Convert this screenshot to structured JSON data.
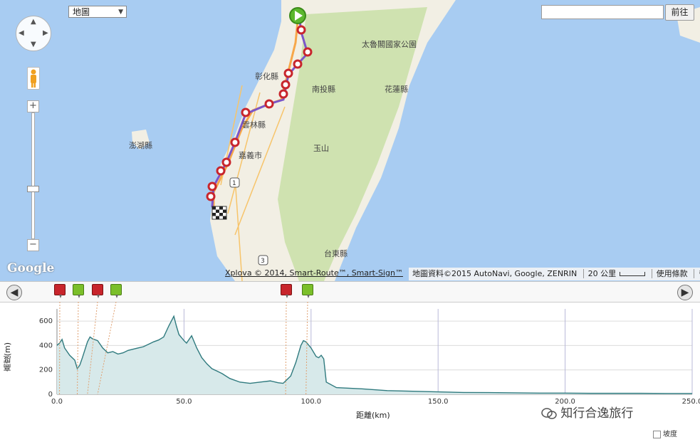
{
  "map": {
    "type_select": "地圖",
    "search_placeholder": "",
    "search_button": "前往",
    "attribution": "Xplova © 2014, Smart-Route™, Smart-Sign™",
    "map_data": "地圖資料©2015 AutoNavi, Google, ZENRIN",
    "scale": "20 公里",
    "terms": "使用條款",
    "google_logo": "Google",
    "labels": {
      "taroko": "太魯閣國家公園",
      "changhua": "彰化縣",
      "nantou": "南投縣",
      "hualien": "花蓮縣",
      "yunlin": "雲林縣",
      "penghu": "澎湖縣",
      "chiayi": "嘉義市",
      "yushan": "玉山",
      "taitung": "台東縣",
      "road1": "1",
      "road3": "3"
    },
    "colors": {
      "sea": "#a8ccf2",
      "land": "#f2efe4",
      "mountain": "#cfe2b0",
      "route": "#7a56c9",
      "waypoint": "#c8252c",
      "start": "#5cb82e"
    }
  },
  "profile": {
    "ylabel": "高度(m)",
    "xlabel": "距離(km)",
    "slope_label": "坡度",
    "watermark": "知行合逸旅行",
    "markers": [
      {
        "kind": "red",
        "label": "climb-start"
      },
      {
        "kind": "green",
        "label": "climb-end"
      },
      {
        "kind": "red",
        "label": "climb-start"
      },
      {
        "kind": "green",
        "label": "climb-end"
      },
      {
        "kind": "red",
        "label": "climb-start"
      },
      {
        "kind": "green",
        "label": "climb-end"
      }
    ]
  },
  "chart_data": {
    "type": "area",
    "title": "",
    "xlabel": "距離(km)",
    "ylabel": "高度(m)",
    "xlim": [
      0,
      250
    ],
    "ylim": [
      0,
      700
    ],
    "xticks": [
      "0.0",
      "50.0",
      "100.0",
      "150.0",
      "200.0",
      "250.0"
    ],
    "yticks": [
      "0",
      "200",
      "400",
      "600"
    ],
    "grid": true,
    "marker_x": [
      1,
      8,
      12,
      16,
      90,
      98
    ],
    "series": [
      {
        "name": "",
        "x": [
          0,
          1,
          2,
          3,
          5,
          7,
          8,
          9,
          10,
          12,
          13,
          14,
          16,
          18,
          20,
          22,
          24,
          26,
          28,
          30,
          32,
          34,
          36,
          38,
          40,
          42,
          44,
          45,
          46,
          47,
          48,
          50,
          51,
          52,
          53,
          54,
          55,
          57,
          59,
          61,
          63,
          65,
          68,
          72,
          76,
          80,
          84,
          87,
          89,
          90,
          92,
          94,
          96,
          97,
          98,
          100,
          102,
          103,
          104,
          105,
          106,
          110,
          120,
          130,
          140,
          150,
          160,
          170,
          180,
          190,
          200,
          210,
          220,
          230,
          240,
          250
        ],
        "y": [
          400,
          420,
          450,
          380,
          320,
          280,
          210,
          240,
          300,
          430,
          470,
          455,
          440,
          380,
          340,
          350,
          330,
          340,
          360,
          370,
          380,
          390,
          410,
          430,
          445,
          470,
          560,
          600,
          640,
          560,
          490,
          440,
          420,
          450,
          480,
          430,
          380,
          300,
          250,
          210,
          190,
          170,
          130,
          100,
          90,
          100,
          110,
          95,
          90,
          110,
          150,
          260,
          400,
          440,
          430,
          380,
          310,
          300,
          320,
          290,
          100,
          55,
          45,
          30,
          25,
          20,
          15,
          14,
          12,
          10,
          10,
          8,
          8,
          8,
          7,
          7
        ]
      }
    ]
  }
}
